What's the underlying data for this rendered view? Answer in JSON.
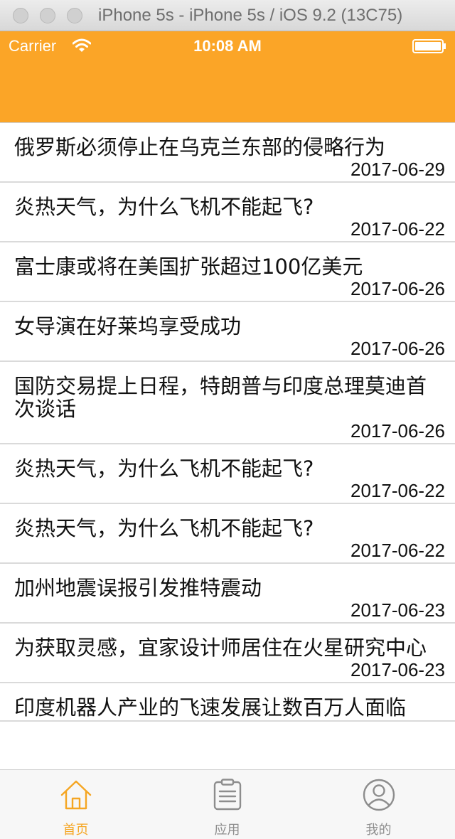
{
  "simulator": {
    "title": "iPhone 5s - iPhone 5s / iOS 9.2 (13C75)"
  },
  "status_bar": {
    "carrier": "Carrier",
    "time": "10:08 AM"
  },
  "colors": {
    "header": "#fba527",
    "accent": "#f5a623",
    "inactive": "#8d8d8d"
  },
  "news": [
    {
      "title": "俄罗斯必须停止在乌克兰东部的侵略行为",
      "date": "2017-06-29"
    },
    {
      "title": "炎热天气，为什么飞机不能起飞?",
      "date": "2017-06-22"
    },
    {
      "title": "富士康或将在美国扩张超过100亿美元",
      "date": "2017-06-26"
    },
    {
      "title": "女导演在好莱坞享受成功",
      "date": "2017-06-26"
    },
    {
      "title": "国防交易提上日程，特朗普与印度总理莫迪首次谈话",
      "date": "2017-06-26"
    },
    {
      "title": "炎热天气，为什么飞机不能起飞?",
      "date": "2017-06-22"
    },
    {
      "title": "炎热天气，为什么飞机不能起飞?",
      "date": "2017-06-22"
    },
    {
      "title": "加州地震误报引发推特震动",
      "date": "2017-06-23"
    },
    {
      "title": "为获取灵感，宜家设计师居住在火星研究中心",
      "date": "2017-06-23"
    },
    {
      "title": "印度机器人产业的飞速发展让数百万人面临",
      "date": ""
    }
  ],
  "tabbar": {
    "home": {
      "label": "首页",
      "icon": "home-icon"
    },
    "apps": {
      "label": "应用",
      "icon": "clipboard-icon"
    },
    "mine": {
      "label": "我的",
      "icon": "user-icon"
    }
  }
}
